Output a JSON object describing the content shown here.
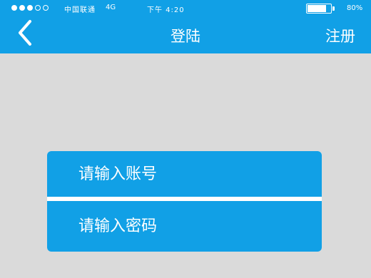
{
  "status_bar": {
    "signal_bars_filled": 3,
    "signal_bars_total": 5,
    "carrier": "中国联通",
    "network": "4G",
    "time": "下午 4:20",
    "battery_percent": "80%",
    "battery_level": 0.8
  },
  "nav": {
    "back_icon": "chevron-left-icon",
    "title": "登陆",
    "register_label": "注册"
  },
  "form": {
    "account_placeholder": "请输入账号",
    "password_placeholder": "请输入密码"
  },
  "colors": {
    "primary": "#11a0e6",
    "background": "#dadada",
    "text": "#ffffff"
  }
}
